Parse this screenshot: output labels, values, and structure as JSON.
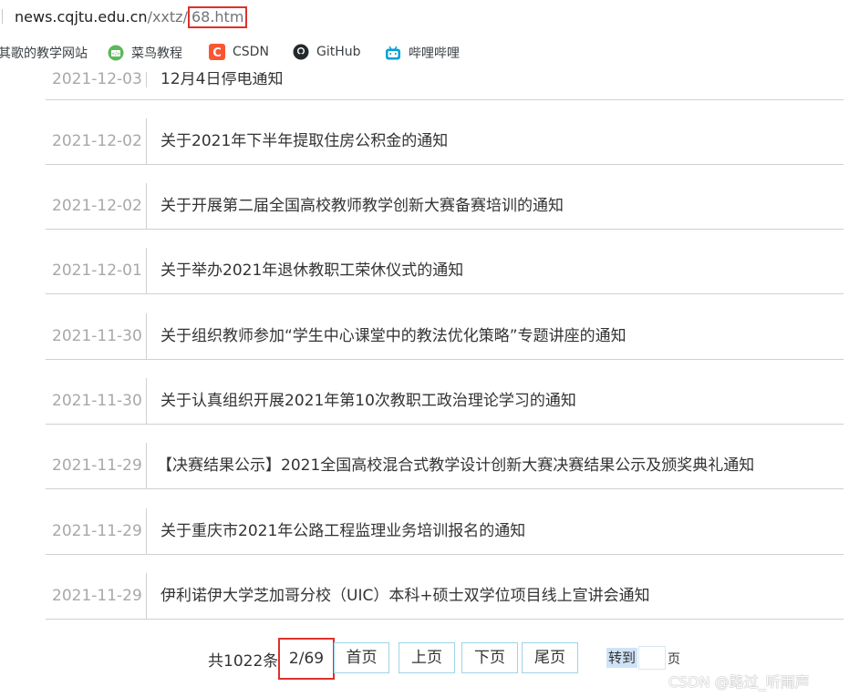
{
  "browser": {
    "url_host": "news.cqjtu.edu.cn",
    "url_path": "/xxtz/",
    "url_highlight": "68.htm"
  },
  "bookmarks": [
    {
      "label": "其歌的教学网站",
      "icon": "web-icon"
    },
    {
      "label": "菜鸟教程",
      "icon": "runoob-icon"
    },
    {
      "label": "CSDN",
      "icon": "csdn-icon"
    },
    {
      "label": "GitHub",
      "icon": "github-icon"
    },
    {
      "label": "哔哩哔哩",
      "icon": "bilibili-icon"
    }
  ],
  "notices": [
    {
      "date": "2021-12-03",
      "title": "12月4日停电通知"
    },
    {
      "date": "2021-12-02",
      "title": "关于2021年下半年提取住房公积金的通知"
    },
    {
      "date": "2021-12-02",
      "title": "关于开展第二届全国高校教师教学创新大赛备赛培训的通知"
    },
    {
      "date": "2021-12-01",
      "title": "关于举办2021年退休教职工荣休仪式的通知"
    },
    {
      "date": "2021-11-30",
      "title": "关于组织教师参加“学生中心课堂中的教法优化策略”专题讲座的通知"
    },
    {
      "date": "2021-11-30",
      "title": "关于认真组织开展2021年第10次教职工政治理论学习的通知"
    },
    {
      "date": "2021-11-29",
      "title": "【决赛结果公示】2021全国高校混合式教学设计创新大赛决赛结果公示及颁奖典礼通知"
    },
    {
      "date": "2021-11-29",
      "title": "关于重庆市2021年公路工程监理业务培训报名的通知"
    },
    {
      "date": "2021-11-29",
      "title": "伊利诺伊大学芝加哥分校（UIC）本科+硕士双学位项目线上宣讲会通知"
    }
  ],
  "pagination": {
    "total_text": "共1022条",
    "current": "2/69",
    "first": "首页",
    "prev": "上页",
    "next": "下页",
    "last": "尾页",
    "goto": "转到",
    "page_suffix": "页"
  },
  "watermark": "CSDN @路过_听雨声",
  "colors": {
    "highlight_border": "#e0302b",
    "button_border": "#9fd3e8",
    "date_text": "#a8a8a8",
    "divider": "#d0d0d0"
  }
}
